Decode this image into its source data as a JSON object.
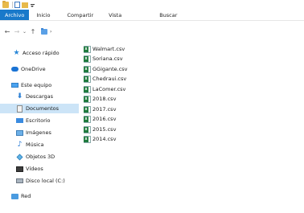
{
  "title_bar": {
    "icons": [
      "folder-icon",
      "properties-check-icon",
      "new-folder-icon",
      "customize-quick-access-icon"
    ]
  },
  "ribbon": {
    "tabs": [
      {
        "label": "Archivo",
        "active": true,
        "color": "#1979ca"
      },
      {
        "label": "Inicio"
      },
      {
        "label": "Compartir"
      },
      {
        "label": "Vista"
      },
      {
        "label": "Buscar"
      }
    ]
  },
  "address_bar": {
    "buttons": [
      "back-arrow-icon",
      "forward-arrow-icon",
      "recent-locations-chevron-icon",
      "up-arrow-icon"
    ],
    "path_icon": "documents-folder-icon",
    "separator": "›"
  },
  "navigation_pane": {
    "items": [
      {
        "label": "Acceso rápido",
        "icon": "quick-access-star-icon"
      },
      {
        "label": "OneDrive",
        "icon": "onedrive-cloud-icon"
      },
      {
        "label": "Este equipo",
        "icon": "this-pc-icon"
      },
      {
        "label": "Descargas",
        "icon": "downloads-icon"
      },
      {
        "label": "Documentos",
        "icon": "documents-icon",
        "selected": true
      },
      {
        "label": "Escritorio",
        "icon": "desktop-icon"
      },
      {
        "label": "Imágenes",
        "icon": "pictures-icon"
      },
      {
        "label": "Música",
        "icon": "music-icon"
      },
      {
        "label": "Objetos 3D",
        "icon": "3d-objects-icon"
      },
      {
        "label": "Vídeos",
        "icon": "videos-icon"
      },
      {
        "label": "Disco local (C:)",
        "icon": "local-disk-icon"
      },
      {
        "label": "Red",
        "icon": "network-icon"
      }
    ]
  },
  "files": [
    {
      "name": "Walmart.csv",
      "icon": "excel-csv-icon"
    },
    {
      "name": "Soriana.csv",
      "icon": "excel-csv-icon"
    },
    {
      "name": "GGigante.csv",
      "icon": "excel-csv-icon"
    },
    {
      "name": "Chedraui.csv",
      "icon": "excel-csv-icon"
    },
    {
      "name": "LaComer.csv",
      "icon": "excel-csv-icon"
    },
    {
      "name": "2018.csv",
      "icon": "excel-csv-icon"
    },
    {
      "name": "2017.csv",
      "icon": "excel-csv-icon"
    },
    {
      "name": "2016.csv",
      "icon": "excel-csv-icon"
    },
    {
      "name": "2015.csv",
      "icon": "excel-csv-icon"
    },
    {
      "name": "2014.csv",
      "icon": "excel-csv-icon"
    }
  ],
  "colors": {
    "accent": "#1979ca",
    "selection": "#cce4f7"
  }
}
